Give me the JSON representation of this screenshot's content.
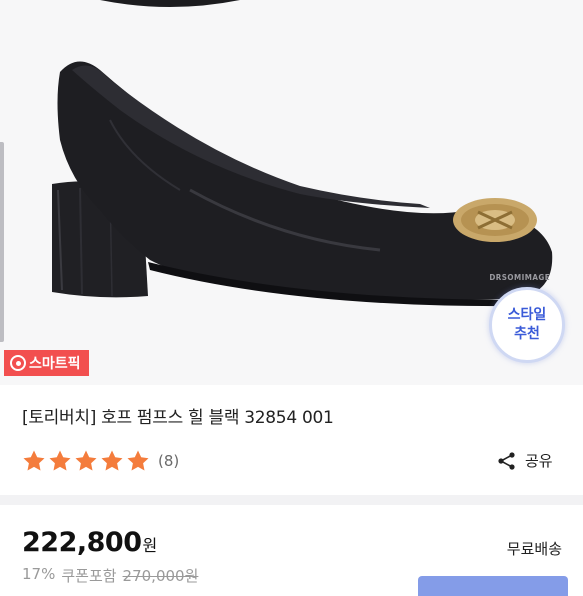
{
  "hero": {
    "image_description": "",
    "watermark": "DRSOMIMAGE",
    "style_badge": {
      "line1": "스타일",
      "line2": "추천"
    },
    "smartpick_label": "스마트픽"
  },
  "product": {
    "title": "[토리버치] 호프 펌프스 힐 블랙 32854 001",
    "rating": 5,
    "review_count": "(8)",
    "share_label": "공유",
    "price": "222,800",
    "currency": "원",
    "shipping": "무료배송",
    "discount_rate": "17%",
    "coupon_label": "쿠폰포함",
    "original_price": "270,000원"
  },
  "colors": {
    "star": "#f47c3c",
    "badge_text": "#3a5bd8",
    "smartpick_bg": "#f24f4f"
  }
}
